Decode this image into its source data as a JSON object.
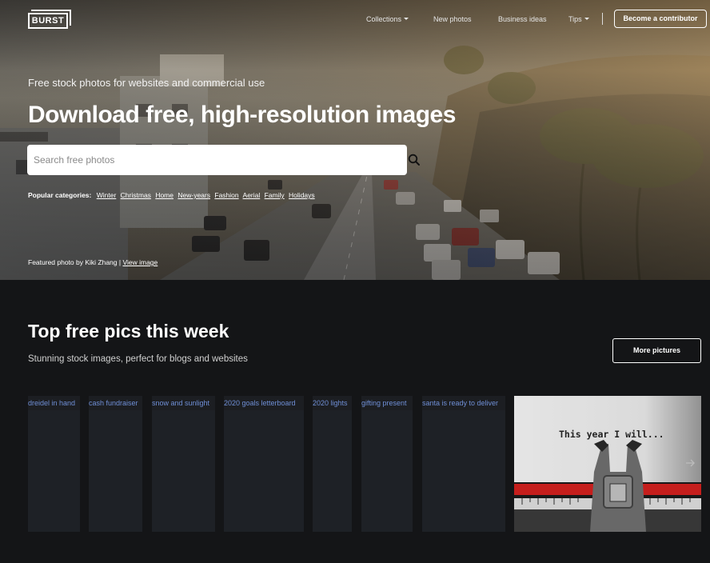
{
  "header": {
    "logo_text": "BURST",
    "nav": [
      {
        "label": "Collections",
        "dropdown": true
      },
      {
        "label": "New photos",
        "dropdown": false
      },
      {
        "label": "Business ideas",
        "dropdown": false
      },
      {
        "label": "Tips",
        "dropdown": true
      }
    ],
    "contributor_button": "Become a contributor"
  },
  "hero": {
    "subtitle": "Free stock photos for websites and commercial use",
    "title": "Download free, high-resolution images",
    "search_placeholder": "Search free photos",
    "popular_label": "Popular categories:",
    "popular_categories": [
      "Winter",
      "Christmas",
      "Home",
      "New-years",
      "Fashion",
      "Aerial",
      "Family",
      "Holidays"
    ],
    "featured_prefix": "Featured photo by Kiki Zhang |",
    "featured_link": "View image"
  },
  "section": {
    "title": "Top free pics this week",
    "subtitle": "Stunning stock images, perfect for blogs and websites",
    "more_button": "More pictures",
    "tiles": [
      "dreidel in hand",
      "cash fundraiser",
      "snow and sunlight",
      "2020 goals letterboard",
      "2020 lights",
      "gifting present",
      "santa is ready to deliver"
    ],
    "featured_tile_text": "This year I will..."
  },
  "colors": {
    "page_bg": "#141517",
    "tile_caption": "#6f8fd6",
    "typewriter_red": "#d0201e"
  },
  "icons": [
    "search-icon",
    "chevron-right-icon",
    "caret-down-icon"
  ]
}
